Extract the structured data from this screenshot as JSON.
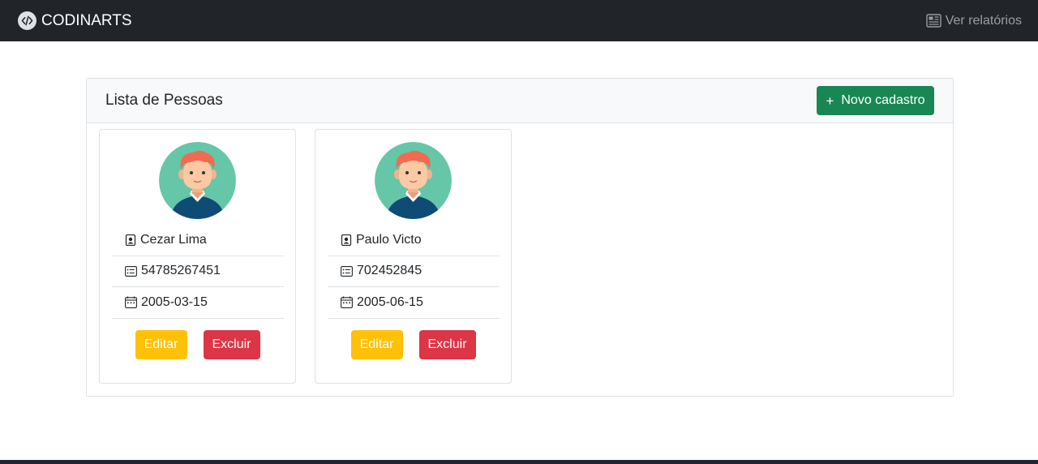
{
  "navbar": {
    "brand": "CODINARTS",
    "brand_icon": "code-slash-icon",
    "reports_link": "Ver relatórios",
    "reports_icon": "newspaper-icon"
  },
  "panel": {
    "title": "Lista de Pessoas",
    "new_button": "Novo cadastro",
    "new_button_icon": "plus-icon"
  },
  "people": [
    {
      "name": "Cezar Lima",
      "document": "54785267451",
      "birthdate": "2005-03-15",
      "edit_label": "Editar",
      "delete_label": "Excluir"
    },
    {
      "name": "Paulo Victo",
      "document": "702452845",
      "birthdate": "2005-06-15",
      "edit_label": "Editar",
      "delete_label": "Excluir"
    }
  ],
  "colors": {
    "navbar": "#212529",
    "success": "#198754",
    "warning": "#ffc107",
    "danger": "#dc3545",
    "avatar_bg": "#66c6a8"
  }
}
